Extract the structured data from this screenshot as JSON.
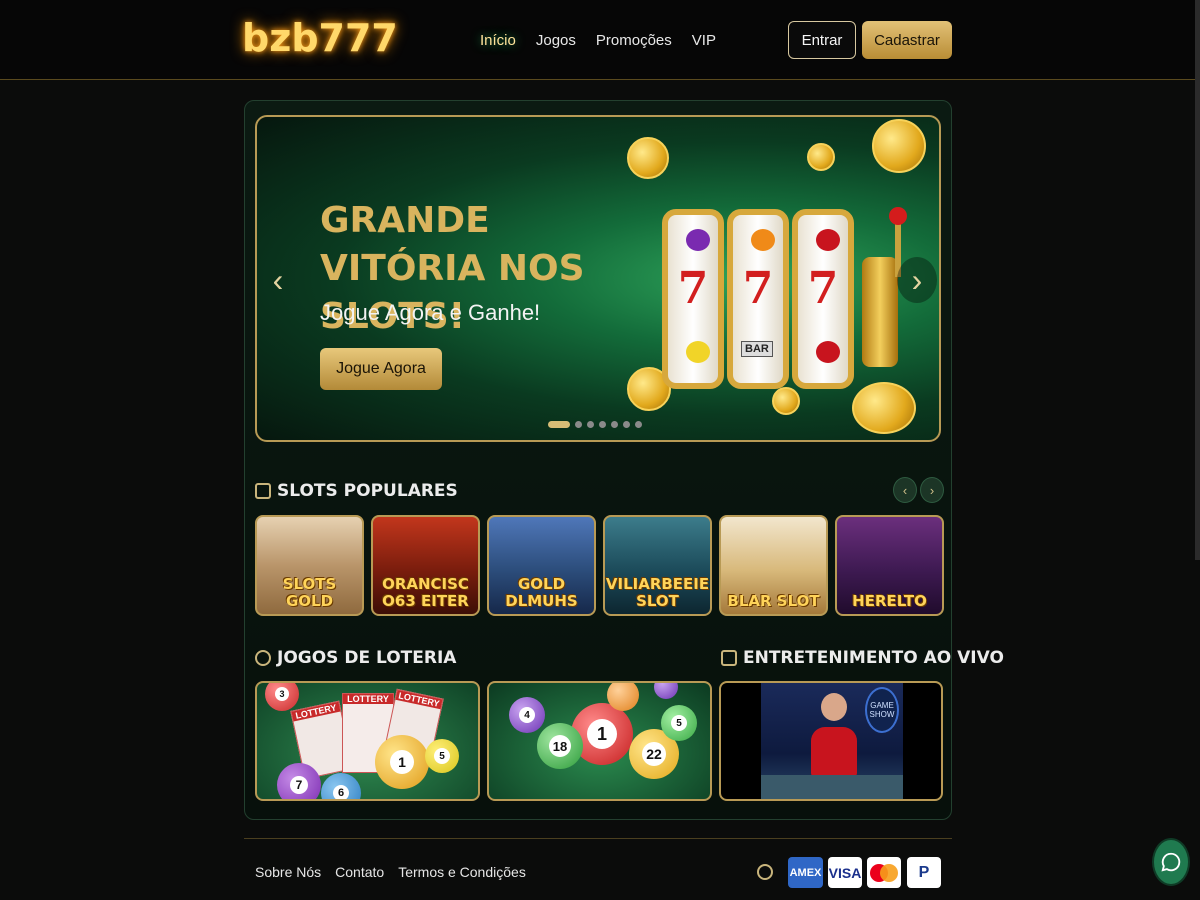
{
  "header": {
    "logo": "bzb777",
    "nav": [
      "Início",
      "Jogos",
      "Promoções",
      "VIP"
    ],
    "login_label": "Entrar",
    "register_label": "Cadastrar"
  },
  "hero": {
    "title": "GRANDE VITÓRIA NOS SLOTS!",
    "subtitle": "Jogue Agora e Ganhe!",
    "cta_label": "Jogue Agora",
    "reel_symbol": "7",
    "bar_label": "BAR",
    "slides_count": 7,
    "active_slide": 1
  },
  "slots_section": {
    "title": "SLOTS POPULARES",
    "games": [
      "SLOTS GOLD",
      "ORANCISC O63 EITER",
      "GOLD DLMUHS",
      "VILIARBEEIE SLOT",
      "BLAR SLOT",
      "HERELTO"
    ]
  },
  "lottery_section": {
    "title": "JOGOS DE LOTERIA",
    "ticket_label": "LOTTERY"
  },
  "live_section": {
    "title": "ENTRETENIMENTO AO VIVO",
    "tv_label": "GAME SHOW"
  },
  "footer": {
    "links": [
      "Sobre Nós",
      "Contato",
      "Termos e Condições"
    ],
    "payments": [
      "AMEX",
      "VISA",
      "mastercard",
      "P"
    ]
  },
  "colors": {
    "gold": "#d9b45e",
    "green_bg": "#0b1a12",
    "chat_green": "#1f7a4f"
  }
}
